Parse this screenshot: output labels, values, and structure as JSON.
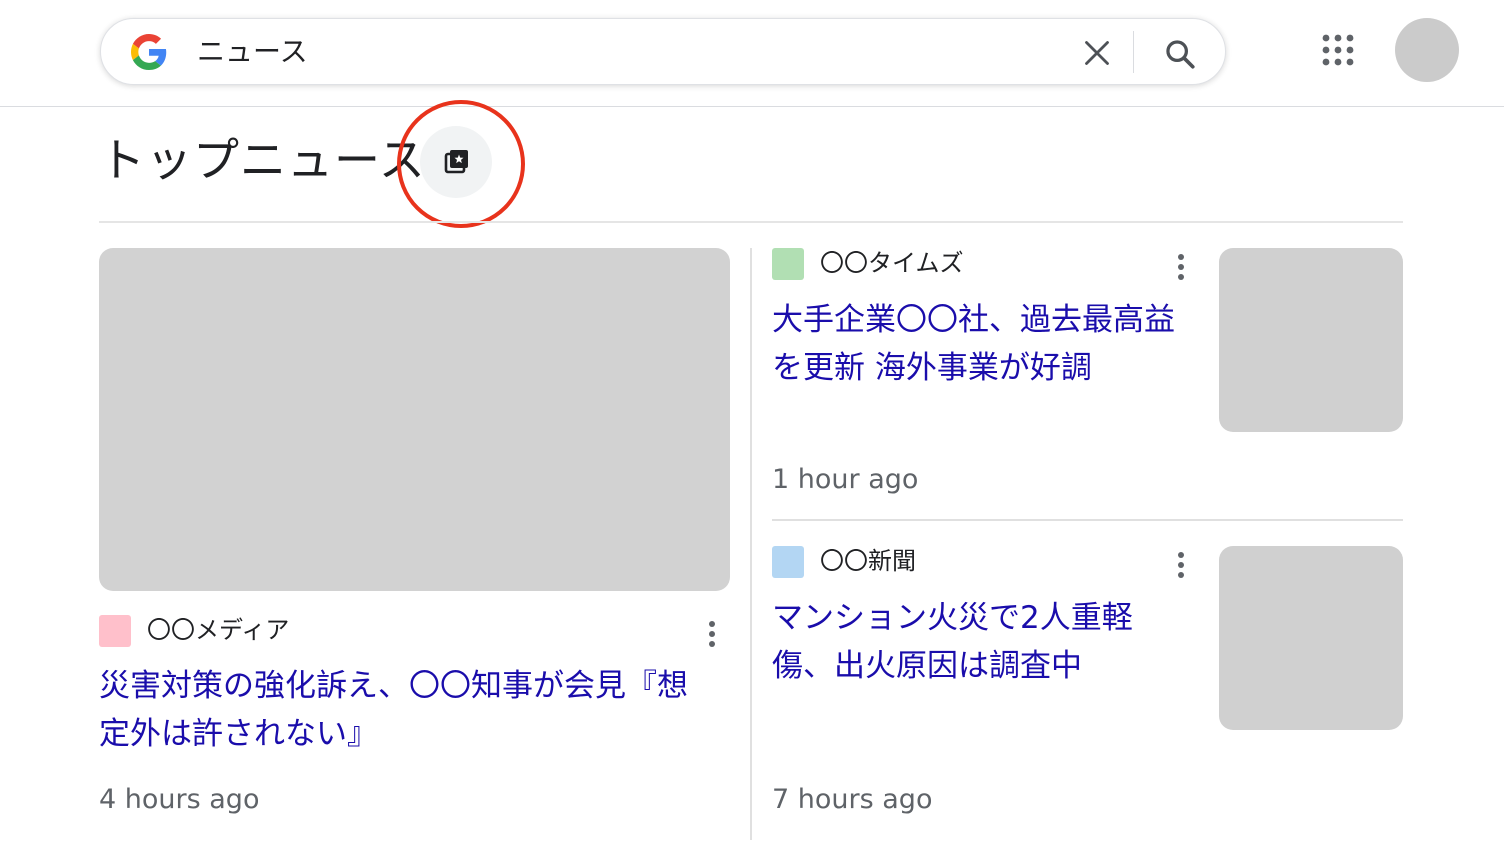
{
  "search": {
    "query": "ニュース"
  },
  "section": {
    "title": "トップニュース"
  },
  "colors": {
    "link": "#1a0dab",
    "annotation": "#e8331c"
  },
  "articles": [
    {
      "source": "〇〇メディア",
      "favicon_color": "#ffc0cb",
      "headline_line1": "災害対策の強化訴え、〇〇知事が会見『想",
      "headline_line2": "定外は許されない』",
      "time": "4 hours ago"
    },
    {
      "source": "〇〇タイムズ",
      "favicon_color": "#b1dfb3",
      "headline_line1": "大手企業〇〇社、過去最高益",
      "headline_line2": "を更新 海外事業が好調",
      "time": "1 hour ago"
    },
    {
      "source": "〇〇新聞",
      "favicon_color": "#b3d6f3",
      "headline_line1": "マンション火災で2人重軽",
      "headline_line2": "傷、出火原因は調査中",
      "time": "7 hours ago"
    }
  ]
}
